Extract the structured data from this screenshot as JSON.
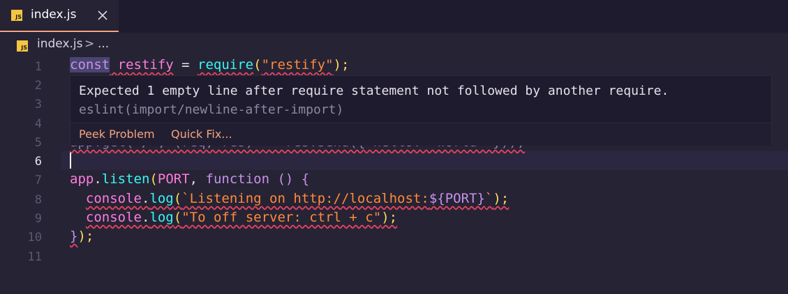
{
  "tab": {
    "icon": "JS",
    "label": "index.js"
  },
  "breadcrumb": {
    "icon": "JS",
    "file": "index.js",
    "separator": ">",
    "more": "..."
  },
  "gutter": [
    "1",
    "2",
    "3",
    "4",
    "5",
    "6",
    "7",
    "8",
    "9",
    "10",
    "11"
  ],
  "code": {
    "line1": {
      "kw": "const",
      "name": " restify",
      "eq": " = ",
      "fn": "require",
      "open": "(",
      "str": "\"restify\"",
      "close": ");"
    },
    "line5_partial": "app.get(\"/\", (req, res) => res.send({ hello: \"world\" }));",
    "line7": {
      "obj": "app",
      "dot": ".",
      "fn": "listen",
      "open": "(",
      "arg": "PORT",
      "comma": ", ",
      "kw": "function",
      "rest": " () {"
    },
    "line8": {
      "indent": "  ",
      "obj": "console",
      "dot": ".",
      "fn": "log",
      "open": "(",
      "str1": "`Listening on http://localhost:",
      "tpl": "${PORT}",
      "str2": "`",
      "close": ");"
    },
    "line9": {
      "indent": "  ",
      "obj": "console",
      "dot": ".",
      "fn": "log",
      "open": "(",
      "str": "\"To off server: ctrl + c\"",
      "close": ");"
    },
    "line10": {
      "brace": "}",
      "rest": ");"
    }
  },
  "hover": {
    "message": "Expected 1 empty line after require statement not followed by another require.",
    "source": "eslint(import/newline-after-import)",
    "actions": [
      "Peek Problem",
      "Quick Fix..."
    ]
  }
}
